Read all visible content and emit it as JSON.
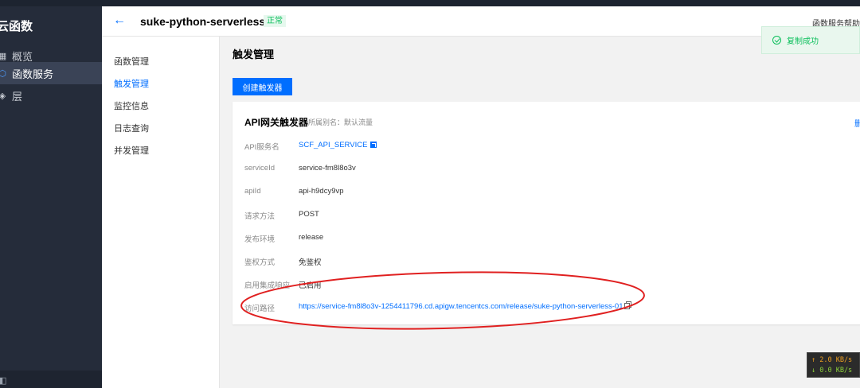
{
  "sidebar": {
    "brand": "云函数",
    "items": [
      {
        "icon": "grid-icon",
        "label": "概览",
        "active": false
      },
      {
        "icon": "hexagon-icon",
        "label": "函数服务",
        "active": true
      },
      {
        "icon": "layers-icon",
        "label": "层",
        "active": false
      }
    ]
  },
  "header": {
    "back_icon": "arrow-left-icon",
    "title": "suke-python-serverless-01",
    "status": "正常",
    "help": "函数服务帮助文"
  },
  "subnav": {
    "items": [
      {
        "label": "函数管理",
        "active": false
      },
      {
        "label": "触发管理",
        "active": true
      },
      {
        "label": "监控信息",
        "active": false
      },
      {
        "label": "日志查询",
        "active": false
      },
      {
        "label": "并发管理",
        "active": false
      }
    ]
  },
  "main": {
    "title": "触发管理",
    "create_button": "创建触发器"
  },
  "trigger_card": {
    "title": "API网关触发器",
    "alias": "所属别名：默认流量",
    "delete": "删",
    "rows": [
      {
        "label": "API服务名",
        "value": "SCF_API_SERVICE",
        "link": true
      },
      {
        "label": "serviceId",
        "value": "service-fm8l8o3v"
      },
      {
        "label": "apiId",
        "value": "api-h9dcy9vp"
      },
      {
        "label": "请求方法",
        "value": "POST"
      },
      {
        "label": "发布环境",
        "value": "release"
      },
      {
        "label": "鉴权方式",
        "value": "免鉴权"
      },
      {
        "label": "启用集成响应",
        "value": "已启用"
      },
      {
        "label": "访问路径",
        "value": "https://service-fm8l8o3v-1254411796.cd.apigw.tencentcs.com/release/suke-python-serverless-01",
        "link": true
      }
    ]
  },
  "toast": {
    "message": "复制成功",
    "color": "#0abf5b"
  },
  "speed_monitor": {
    "up": "↑ 2.0 KB/s",
    "down": "↓ 0.0 KB/s"
  },
  "colors": {
    "accent": "#006eff",
    "sidebar_bg": "#252c3a",
    "annotation": "#e02020"
  }
}
